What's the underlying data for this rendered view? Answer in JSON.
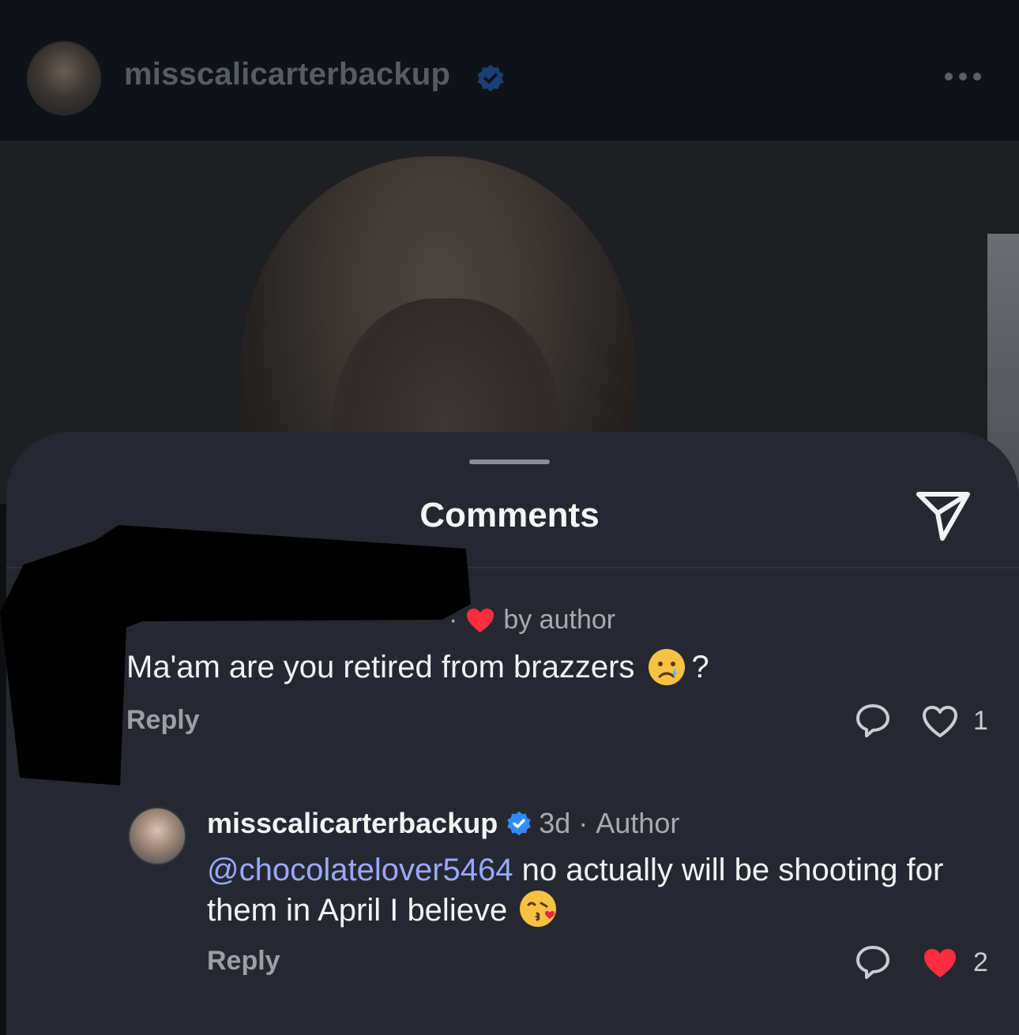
{
  "post_header": {
    "username": "misscalicarterbackup",
    "verified": true,
    "more_icon": "more-horizontal-icon"
  },
  "sheet": {
    "title": "Comments",
    "share_icon": "send-icon"
  },
  "comments": [
    {
      "meta_separator": "·",
      "liked_by_author_label": "by author",
      "text": "Ma'am are you retired from brazzers",
      "emoji": "crying-face",
      "text_suffix": "?",
      "reply_label": "Reply",
      "like_count": "1",
      "liked": false
    }
  ],
  "replies": [
    {
      "username": "misscalicarterbackup",
      "verified": true,
      "time": "3d",
      "separator": "·",
      "role": "Author",
      "mention": "@chocolatelover5464",
      "text": " no actually will be shooting for them in April I believe",
      "emoji": "face-blowing-kiss",
      "reply_label": "Reply",
      "like_count": "2",
      "liked": true
    }
  ],
  "colors": {
    "accent_blue": "#2f8cff",
    "like_red": "#ff2d3f",
    "mention": "#9aa8ff",
    "sheet_bg": "#252830"
  }
}
